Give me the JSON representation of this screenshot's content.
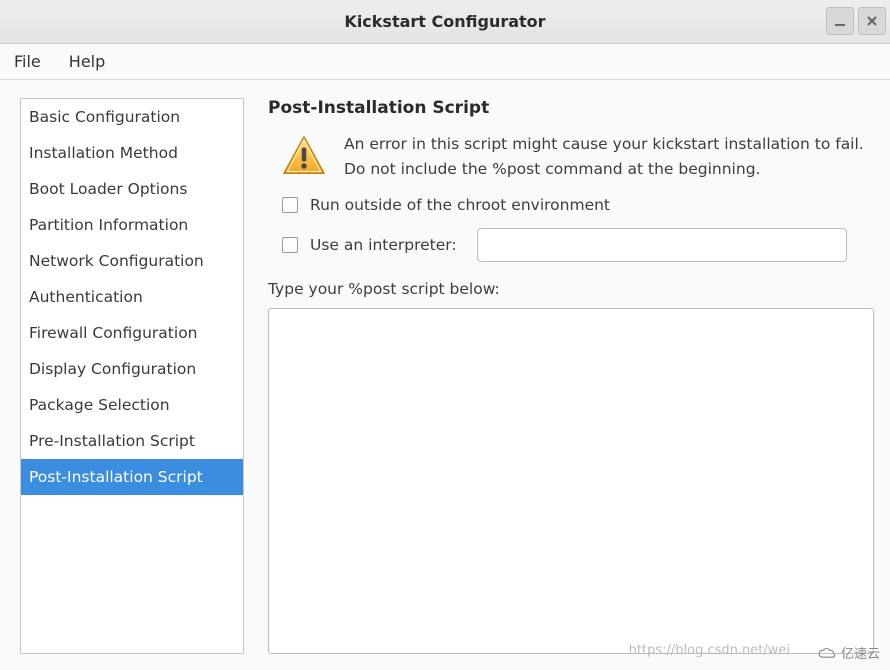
{
  "window": {
    "title": "Kickstart Configurator"
  },
  "menubar": {
    "file": "File",
    "help": "Help"
  },
  "sidebar": {
    "items": [
      {
        "label": "Basic Configuration",
        "selected": false
      },
      {
        "label": "Installation Method",
        "selected": false
      },
      {
        "label": "Boot Loader Options",
        "selected": false
      },
      {
        "label": "Partition Information",
        "selected": false
      },
      {
        "label": "Network Configuration",
        "selected": false
      },
      {
        "label": "Authentication",
        "selected": false
      },
      {
        "label": "Firewall Configuration",
        "selected": false
      },
      {
        "label": "Display Configuration",
        "selected": false
      },
      {
        "label": "Package Selection",
        "selected": false
      },
      {
        "label": "Pre-Installation Script",
        "selected": false
      },
      {
        "label": "Post-Installation Script",
        "selected": true
      }
    ]
  },
  "main": {
    "section_title": "Post-Installation Script",
    "warning_text": "An error in this script might cause your kickstart installation to fail. Do not include the %post command at the beginning.",
    "chroot_label": "Run outside of the chroot environment",
    "chroot_checked": false,
    "interpreter_label": "Use an interpreter:",
    "interpreter_checked": false,
    "interpreter_value": "",
    "script_label": "Type your %post script below:",
    "script_value": ""
  },
  "watermark": "https://blog.csdn.net/wei",
  "brand": "亿速云"
}
